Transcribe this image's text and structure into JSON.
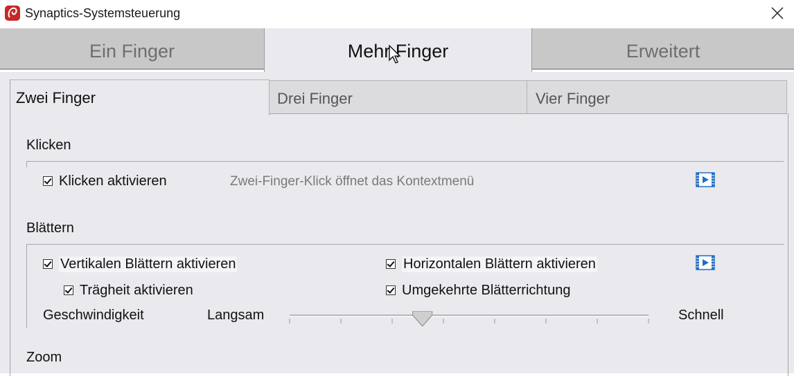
{
  "window": {
    "title": "Synaptics-Systemsteuerung"
  },
  "main_tabs": [
    {
      "label": "Ein Finger"
    },
    {
      "label": "Mehr Finger"
    },
    {
      "label": "Erweitert"
    }
  ],
  "sub_tabs": [
    {
      "label": "Zwei Finger"
    },
    {
      "label": "Drei Finger"
    },
    {
      "label": "Vier Finger"
    }
  ],
  "klicken": {
    "title": "Klicken",
    "enable_label": "Klicken aktivieren",
    "enable_checked": true,
    "hint": "Zwei-Finger-Klick öffnet das Kontextmenü"
  },
  "blaettern": {
    "title": "Blättern",
    "vertical_label": "Vertikalen Blättern aktivieren",
    "vertical_checked": true,
    "horizontal_label": "Horizontalen Blättern aktivieren",
    "horizontal_checked": true,
    "inertia_label": "Trägheit aktivieren",
    "inertia_checked": true,
    "reverse_label": "Umgekehrte Blätterrichtung",
    "reverse_checked": true,
    "speed_label": "Geschwindigkeit",
    "slow_label": "Langsam",
    "fast_label": "Schnell",
    "speed_value": 0.37
  },
  "zoom": {
    "title": "Zoom"
  },
  "icons": {
    "app": "synaptics-logo-icon",
    "close": "close-icon",
    "video": "video-play-icon",
    "cursor": "mouse-pointer-icon"
  },
  "colors": {
    "app_icon": "#c62828",
    "video_icon": "#1e6fc4"
  }
}
